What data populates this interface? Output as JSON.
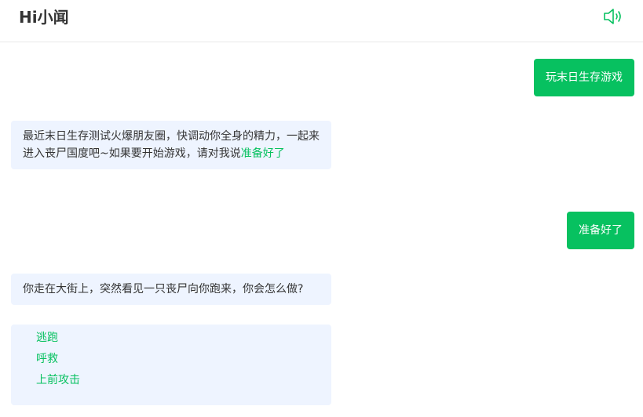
{
  "header": {
    "title": "Hi小闻",
    "speaker_icon": "speaker-icon"
  },
  "colors": {
    "accent": "#07c160",
    "bot_bubble": "#eef4ff"
  },
  "messages": [
    {
      "role": "user",
      "text": "玩末日生存游戏"
    },
    {
      "role": "bot",
      "text": "最近末日生存测试火爆朋友圈，快调动你全身的精力，一起来进入丧尸国度吧~如果要开始游戏，请对我说",
      "link": "准备好了"
    },
    {
      "role": "user",
      "text": "准备好了"
    },
    {
      "role": "bot",
      "text": "你走在大街上，突然看见一只丧尸向你跑来，你会怎么做?",
      "options": [
        "逃跑",
        "呼救",
        "上前攻击"
      ]
    }
  ]
}
